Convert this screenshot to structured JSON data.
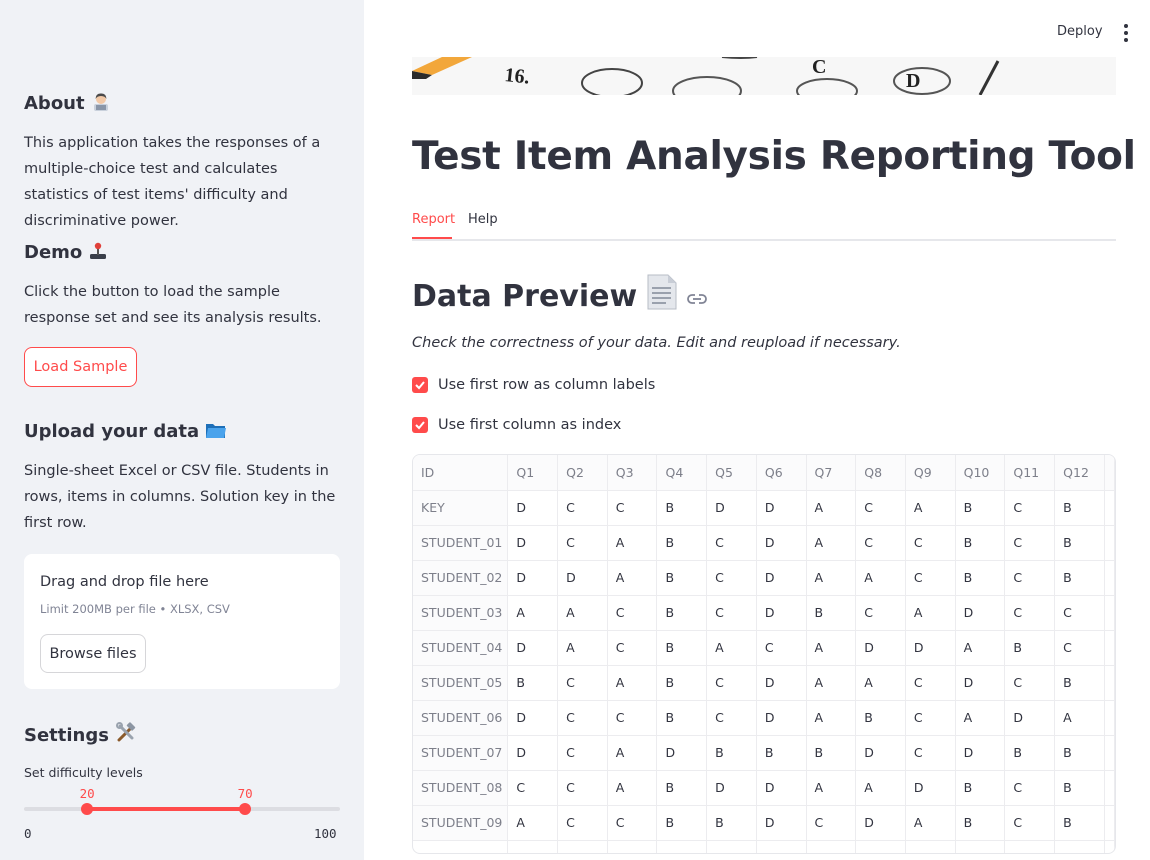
{
  "header": {
    "deploy_label": "Deploy"
  },
  "sidebar": {
    "about": {
      "heading": "About",
      "text": "This application takes the responses of a multiple-choice test and calculates statistics of test items' difficulty and discriminative power."
    },
    "demo": {
      "heading": "Demo",
      "text": "Click the button to load the sample response set and see its analysis results.",
      "button_label": "Load Sample"
    },
    "upload": {
      "heading": "Upload your data",
      "text": "Single-sheet Excel or CSV file. Students in rows, items in columns. Solution key in the first row.",
      "dropzone_title": "Drag and drop file here",
      "dropzone_limit": "Limit 200MB per file • XLSX, CSV",
      "browse_label": "Browse files"
    },
    "settings": {
      "heading": "Settings",
      "slider_label": "Set difficulty levels",
      "slider_low": 20,
      "slider_high": 70,
      "slider_min": 0,
      "slider_max": 100
    }
  },
  "main": {
    "title": "Test Item Analysis Reporting Tool",
    "tabs": [
      {
        "label": "Report",
        "active": true
      },
      {
        "label": "Help",
        "active": false
      }
    ],
    "section_heading": "Data Preview",
    "caption": "Check the correctness of your data. Edit and reupload if necessary.",
    "checkboxes": [
      {
        "label": "Use first row as column labels",
        "checked": true
      },
      {
        "label": "Use first column as index",
        "checked": true
      }
    ],
    "table": {
      "columns": [
        "ID",
        "Q1",
        "Q2",
        "Q3",
        "Q4",
        "Q5",
        "Q6",
        "Q7",
        "Q8",
        "Q9",
        "Q10",
        "Q11",
        "Q12"
      ],
      "rows": [
        [
          "KEY",
          "D",
          "C",
          "C",
          "B",
          "D",
          "D",
          "A",
          "C",
          "A",
          "B",
          "C",
          "B"
        ],
        [
          "STUDENT_01",
          "D",
          "C",
          "A",
          "B",
          "C",
          "D",
          "A",
          "C",
          "C",
          "B",
          "C",
          "B"
        ],
        [
          "STUDENT_02",
          "D",
          "D",
          "A",
          "B",
          "C",
          "D",
          "A",
          "A",
          "C",
          "B",
          "C",
          "B"
        ],
        [
          "STUDENT_03",
          "A",
          "A",
          "C",
          "B",
          "C",
          "D",
          "B",
          "C",
          "A",
          "D",
          "C",
          "C"
        ],
        [
          "STUDENT_04",
          "D",
          "A",
          "C",
          "B",
          "A",
          "C",
          "A",
          "D",
          "D",
          "A",
          "B",
          "C"
        ],
        [
          "STUDENT_05",
          "B",
          "C",
          "A",
          "B",
          "C",
          "D",
          "A",
          "A",
          "C",
          "D",
          "C",
          "B"
        ],
        [
          "STUDENT_06",
          "D",
          "C",
          "C",
          "B",
          "C",
          "D",
          "A",
          "B",
          "C",
          "A",
          "D",
          "A"
        ],
        [
          "STUDENT_07",
          "D",
          "C",
          "A",
          "D",
          "B",
          "B",
          "B",
          "D",
          "C",
          "D",
          "B",
          "B"
        ],
        [
          "STUDENT_08",
          "C",
          "C",
          "A",
          "B",
          "D",
          "D",
          "A",
          "A",
          "D",
          "B",
          "C",
          "B"
        ],
        [
          "STUDENT_09",
          "A",
          "C",
          "C",
          "B",
          "B",
          "D",
          "C",
          "D",
          "A",
          "B",
          "C",
          "B"
        ]
      ]
    }
  },
  "colors": {
    "accent": "#ff4b4b",
    "sidebar_bg": "#f0f2f6",
    "text": "#31333f"
  },
  "icons": {
    "about": "woman-technologist-icon",
    "demo": "joystick-icon",
    "upload": "open-folder-icon",
    "settings": "hammer-and-wrench-icon",
    "section": "page-facing-up-icon",
    "anchor": "link-icon",
    "menu": "kebab-menu-icon"
  }
}
